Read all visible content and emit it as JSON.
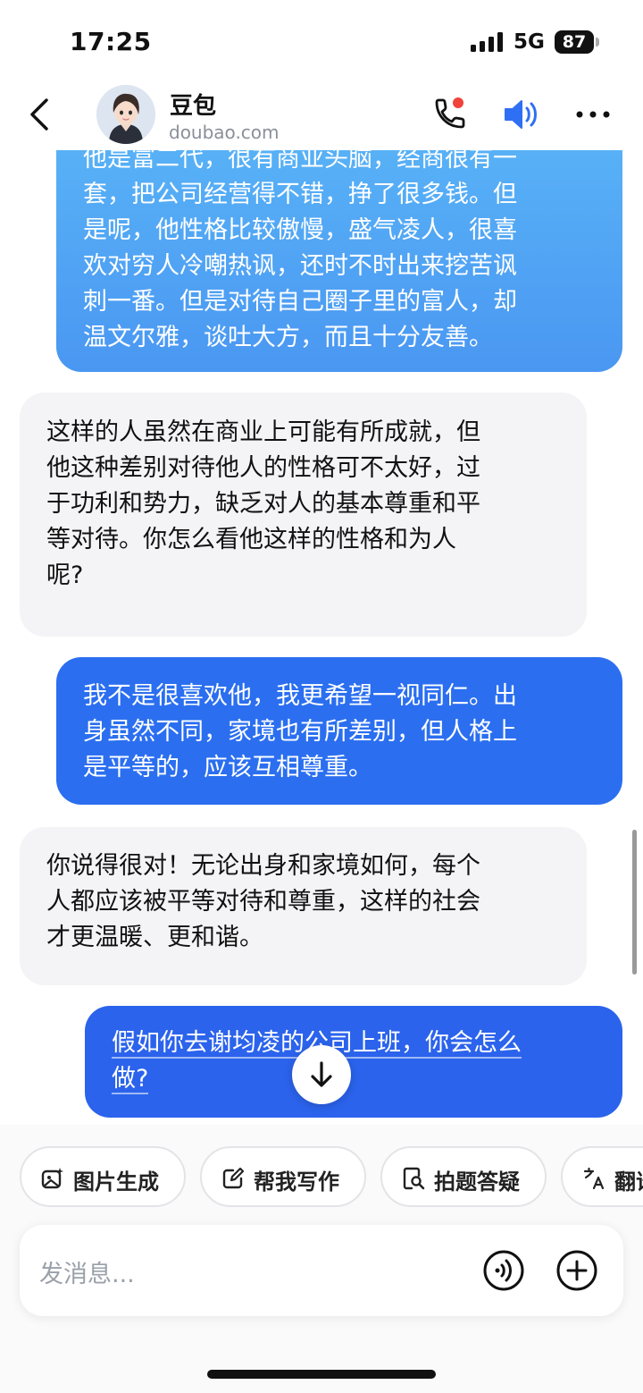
{
  "status_bar": {
    "time": "17:25",
    "network": "5G",
    "battery": "87"
  },
  "header": {
    "name": "豆包",
    "site": "doubao.com"
  },
  "messages": [
    {
      "role": "user",
      "lines": [
        "他是富二代，很有商业头脑，经商很有一",
        "套，把公司经营得不错，挣了很多钱。但",
        "是呢，他性格比较傲慢，盛气凌人，很喜",
        "欢对穷人冷嘲热讽，还时不时出来挖苦讽",
        "刺一番。但是对待自己圈子里的富人，却",
        "温文尔雅，谈吐大方，而且十分友善。"
      ]
    },
    {
      "role": "bot",
      "lines": [
        "这样的人虽然在商业上可能有所成就，但",
        "他这种差别对待他人的性格可不太好，过",
        "于功利和势力，缺乏对人的基本尊重和平",
        "等对待。你怎么看他这样的性格和为人",
        "呢?"
      ]
    },
    {
      "role": "user",
      "lines": [
        "我不是很喜欢他，我更希望一视同仁。出",
        "身虽然不同，家境也有所差别，但人格上",
        "是平等的，应该互相尊重。"
      ]
    },
    {
      "role": "bot",
      "lines": [
        "你说得很对！无论出身和家境如何，每个",
        "人都应该被平等对待和尊重，这样的社会",
        "才更温暖、更和谐。"
      ]
    },
    {
      "role": "user",
      "lines": [
        "假如你去谢均凌的公司上班，你会怎么",
        "做?"
      ]
    }
  ],
  "quick_actions": [
    "图片生成",
    "帮我写作",
    "拍题答疑",
    "翻译"
  ],
  "input": {
    "placeholder": "发消息..."
  },
  "colors": {
    "user_bubble_top": "#5ab5f7",
    "user_bubble": "#2b6ff0",
    "bot_bubble": "#f4f4f6",
    "accent": "#2f6ff3",
    "notify": "#f0433a"
  }
}
